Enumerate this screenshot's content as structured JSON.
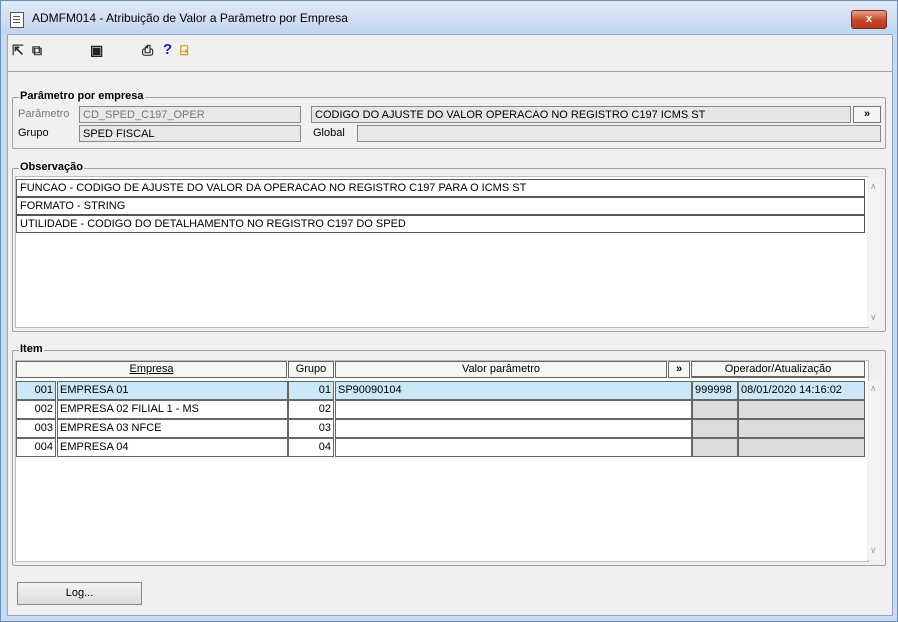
{
  "window": {
    "title": "ADMFM014 - Atribuição de Valor a Parâmetro por Empresa",
    "close_label": "x"
  },
  "toolbar": {
    "icons": [
      "first-icon",
      "previous-icon",
      "save-icon",
      "print-icon",
      "help-icon",
      "exit-icon"
    ],
    "help_glyph": "?"
  },
  "param": {
    "legend": "Parâmetro por empresa",
    "param_label": "Parâmetro",
    "param_value": "CD_SPED_C197_OPER",
    "desc_value": "CODIGO DO AJUSTE DO VALOR OPERACAO NO REGISTRO C197 ICMS ST",
    "more_label": "»",
    "group_label": "Grupo",
    "group_value": "SPED FISCAL",
    "global_label": "Global",
    "global_value": ""
  },
  "obs": {
    "legend": "Observação",
    "lines": [
      "FUNCAO - CODIGO DE AJUSTE DO VALOR DA OPERACAO NO REGISTRO C197 PARA O ICMS ST",
      "FORMATO - STRING",
      "UTILIDADE - CODIGO DO DETALHAMENTO NO REGISTRO C197 DO SPED"
    ]
  },
  "item": {
    "legend": "Item",
    "headers": {
      "empresa": "Empresa",
      "grupo": "Grupo",
      "valor": "Valor parâmetro",
      "more": "»",
      "operador": "Operador/Atualização"
    },
    "rows": [
      {
        "code": "001",
        "empresa": "EMPRESA 01",
        "grupo": "01",
        "valor": "SP90090104",
        "operador": "999998",
        "atualizacao": "08/01/2020 14:16:02"
      },
      {
        "code": "002",
        "empresa": "EMPRESA 02 FILIAL 1 - MS",
        "grupo": "02",
        "valor": "",
        "operador": "",
        "atualizacao": ""
      },
      {
        "code": "003",
        "empresa": "EMPRESA 03 NFCE",
        "grupo": "03",
        "valor": "",
        "operador": "",
        "atualizacao": ""
      },
      {
        "code": "004",
        "empresa": "EMPRESA 04",
        "grupo": "04",
        "valor": "",
        "operador": "",
        "atualizacao": ""
      }
    ]
  },
  "log_button": "Log..."
}
